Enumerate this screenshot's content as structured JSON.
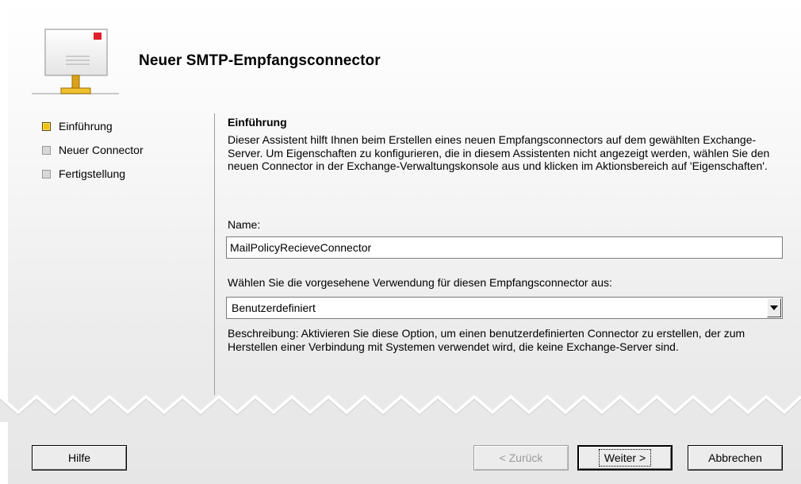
{
  "wizard": {
    "title": "Neuer SMTP-Empfangsconnector"
  },
  "steps": [
    {
      "label": "Einführung",
      "active": true
    },
    {
      "label": "Neuer Connector",
      "active": false
    },
    {
      "label": "Fertigstellung",
      "active": false
    }
  ],
  "page": {
    "section_title": "Einführung",
    "intro": "Dieser Assistent hilft Ihnen beim Erstellen eines neuen Empfangsconnectors auf dem gewählten Exchange-Server. Um Eigenschaften zu konfigurieren, die in diesem Assistenten nicht angezeigt werden, wählen Sie den neuen Connector in der Exchange-Verwaltungskonsole aus und klicken im Aktionsbereich auf 'Eigenschaften'.",
    "name_label": "Name:",
    "name_value": "MailPolicyRecieveConnector",
    "usage_label": "Wählen Sie die vorgesehene Verwendung für diesen Empfangsconnector aus:",
    "usage_value": "Benutzerdefiniert",
    "description": "Beschreibung: Aktivieren Sie diese Option, um einen benutzerdefinierten Connector zu erstellen, der zum Herstellen einer Verbindung mit Systemen verwendet wird, die keine Exchange-Server sind."
  },
  "buttons": {
    "help": "Hilfe",
    "back": "< Zurück",
    "next": "Weiter >",
    "cancel": "Abbrechen"
  },
  "colors": {
    "active_step": "#f2c200",
    "inactive_step": "#d8d8d8"
  }
}
